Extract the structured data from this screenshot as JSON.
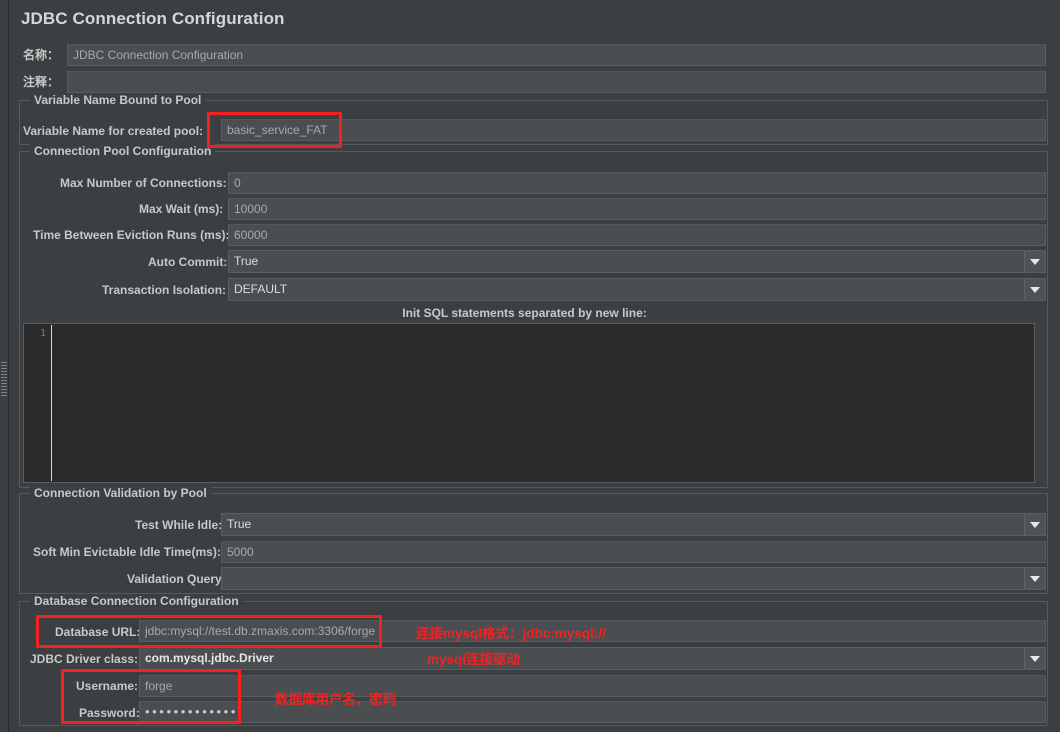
{
  "window": {
    "title": "JDBC Connection Configuration"
  },
  "meta": {
    "name_label": "名称：",
    "name_value": "JDBC Connection Configuration",
    "comment_label": "注释：",
    "comment_value": ""
  },
  "variable_group": {
    "title": "Variable Name Bound to Pool",
    "pool_var_label": "Variable Name for created pool:",
    "pool_var_value": "basic_service_FAT"
  },
  "pool_group": {
    "title": "Connection Pool Configuration",
    "rows": [
      {
        "label": "Max Number of Connections:",
        "value": "0",
        "type": "text"
      },
      {
        "label": "Max Wait (ms):",
        "value": "10000",
        "type": "text"
      },
      {
        "label": "Time Between Eviction Runs (ms):",
        "value": "60000",
        "type": "text"
      },
      {
        "label": "Auto Commit:",
        "value": "True",
        "type": "combo"
      },
      {
        "label": "Transaction Isolation:",
        "value": "DEFAULT",
        "type": "combo"
      }
    ],
    "init_sql_label": "Init SQL statements separated by new line:",
    "init_sql_value": "",
    "init_sql_line_number": "1"
  },
  "validation_group": {
    "title": "Connection Validation by Pool",
    "rows": [
      {
        "label": "Test While Idle:",
        "value": "True",
        "type": "combo"
      },
      {
        "label": "Soft Min Evictable Idle Time(ms):",
        "value": "5000",
        "type": "text"
      },
      {
        "label": "Validation Query:",
        "value": "",
        "type": "combo"
      }
    ]
  },
  "database_group": {
    "title": "Database Connection Configuration",
    "url_label": "Database URL:",
    "url_value": "jdbc:mysql://test.db.zmaxis.com:3306/forge",
    "driver_label": "JDBC Driver class:",
    "driver_value": "com.mysql.jdbc.Driver",
    "username_label": "Username:",
    "username_value": "forge",
    "password_label": "Password:",
    "password_value": "•••••••••••••"
  },
  "annotations": {
    "url_note": "连接mysql格式：jdbc:mysql://",
    "driver_note": "mysql连接驱动",
    "credentials_note": "数据库用户名、密码"
  },
  "icons": {
    "dropdown": "chevron-down-icon",
    "split_handle": "split-pane-grip-icon"
  },
  "colors": {
    "panel_bg": "#3c3f41",
    "window_bg": "#2b2b2b",
    "field_bg": "#4a4e51",
    "annotation_red": "#f52020",
    "text": "#c8c8c8"
  }
}
